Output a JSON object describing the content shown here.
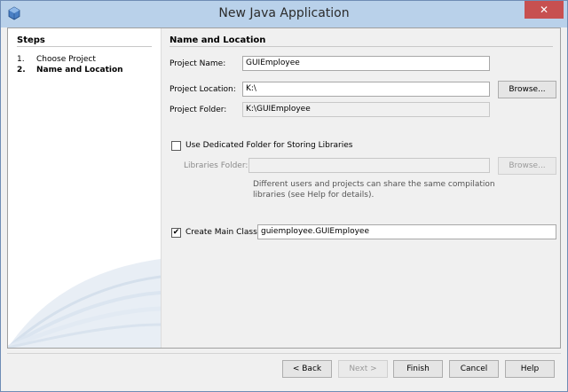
{
  "window": {
    "title": "New Java Application",
    "close_glyph": "✕"
  },
  "steps": {
    "heading": "Steps",
    "items": [
      {
        "num": "1.",
        "label": "Choose Project"
      },
      {
        "num": "2.",
        "label": "Name and Location"
      }
    ]
  },
  "panel": {
    "heading": "Name and Location",
    "project_name": {
      "label": "Project Name:",
      "value": "GUIEmployee"
    },
    "project_location": {
      "label": "Project Location:",
      "value": "K:\\",
      "browse": "Browse..."
    },
    "project_folder": {
      "label": "Project Folder:",
      "value": "K:\\GUIEmployee"
    },
    "dedicated_folder": {
      "label": "Use Dedicated Folder for Storing Libraries",
      "checked": false
    },
    "libraries_folder": {
      "label": "Libraries Folder:",
      "value": "",
      "browse": "Browse..."
    },
    "libraries_desc": "Different users and projects can share the same compilation libraries (see Help for details).",
    "main_class": {
      "label": "Create Main Class",
      "checked": true,
      "check_glyph": "✔",
      "value": "guiemployee.GUIEmployee"
    }
  },
  "footer": {
    "back": "< Back",
    "next": "Next >",
    "finish": "Finish",
    "cancel": "Cancel",
    "help": "Help"
  },
  "colors": {
    "titlebar": "#b9d1ea",
    "close": "#c75050",
    "panel": "#f0f0f0"
  },
  "icons": {
    "app": "netbeans-cube-icon",
    "close": "close-icon"
  }
}
